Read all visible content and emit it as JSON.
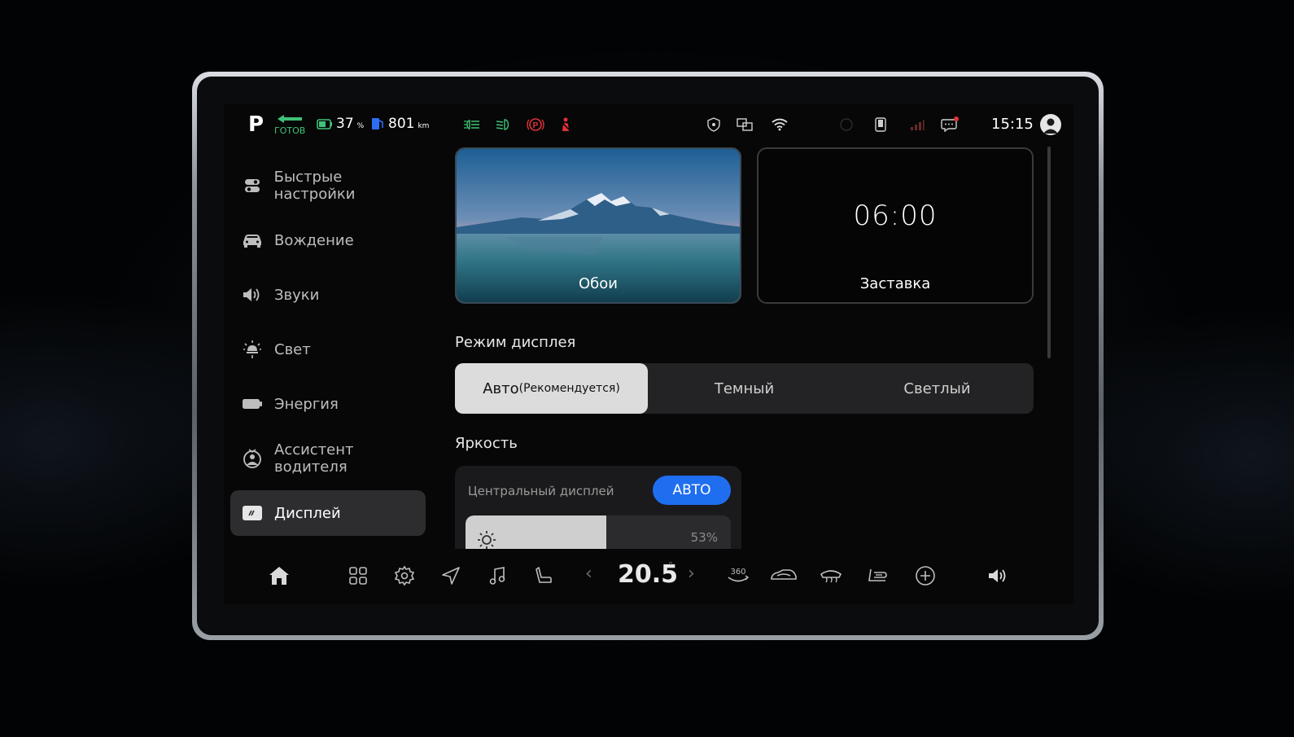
{
  "colors": {
    "accent": "#1f6ef0",
    "ready_green": "#3fc277",
    "warning_red": "#e0313a"
  },
  "status": {
    "gear": "P",
    "ready_text": "ГОТОВ",
    "battery_pct": "37",
    "battery_unit": "%",
    "range_value": "801",
    "range_unit": "km",
    "time": "15:15",
    "indicator_icons": [
      "fog-light-icon",
      "headlight-icon",
      "parking-brake-icon",
      "seatbelt-icon"
    ],
    "system_icons": [
      "shield-icon",
      "screen-cast-icon",
      "wifi-icon",
      "phone-icon",
      "signal-icon",
      "message-icon",
      "user-avatar-icon"
    ]
  },
  "sidebar": {
    "items": [
      {
        "label": "Быстрые настройки",
        "icon": "toggles-icon"
      },
      {
        "label": "Вождение",
        "icon": "car-icon"
      },
      {
        "label": "Звуки",
        "icon": "speaker-icon"
      },
      {
        "label": "Свет",
        "icon": "light-icon"
      },
      {
        "label": "Энергия",
        "icon": "battery-icon"
      },
      {
        "label": "Ассистент водителя",
        "icon": "assistant-icon"
      },
      {
        "label": "Дисплей",
        "icon": "display-icon",
        "active": true
      }
    ]
  },
  "main": {
    "wallpaper_label": "Обои",
    "screensaver_label": "Заставка",
    "screensaver_time": "06:00",
    "display_mode_title": "Режим дисплея",
    "display_modes": [
      {
        "label": "Авто",
        "sub": "(Рекомендуется)",
        "active": true
      },
      {
        "label": "Темный",
        "sub": ""
      },
      {
        "label": "Светлый",
        "sub": ""
      }
    ],
    "brightness_title": "Яркость",
    "central_display_label": "Центральный дисплей",
    "auto_button": "АВТО",
    "brightness_pct": 0.53,
    "brightness_text": "53%"
  },
  "dock": {
    "temperature": "20.5",
    "temperature_unit": "°",
    "icons": [
      "home-icon",
      "apps-icon",
      "settings-icon",
      "navigation-icon",
      "music-icon",
      "seat-icon",
      "camera-360-icon",
      "car-recirculation-icon",
      "rear-defrost-icon",
      "seat-heat-icon",
      "add-icon",
      "volume-icon"
    ],
    "camera_label": "360"
  }
}
